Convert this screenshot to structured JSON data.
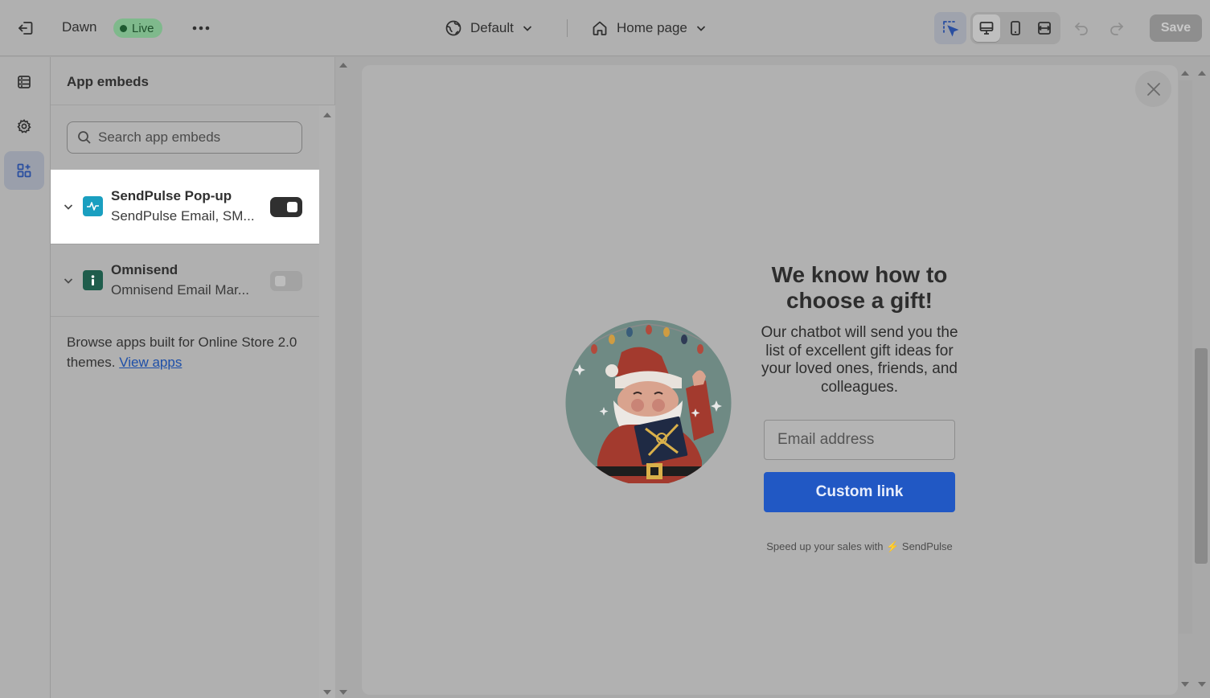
{
  "topbar": {
    "theme_name": "Dawn",
    "status_badge": "Live",
    "locale": "Default",
    "page_select": "Home page",
    "save_label": "Save"
  },
  "rail": {
    "items": [
      {
        "icon": "sections-icon"
      },
      {
        "icon": "settings-gear-icon"
      },
      {
        "icon": "app-embeds-icon",
        "active": true
      }
    ]
  },
  "panel": {
    "title": "App embeds",
    "search_placeholder": "Search app embeds",
    "embeds": [
      {
        "name": "SendPulse Pop-up",
        "description": "SendPulse Email, SM...",
        "enabled": true
      },
      {
        "name": "Omnisend",
        "description": "Omnisend Email Mar...",
        "enabled": false
      }
    ],
    "browse_text": "Browse apps built for Online Store 2.0 themes.",
    "browse_link": "View apps"
  },
  "popup": {
    "title": "We know how to choose a gift!",
    "text": "Our chatbot will send you the list of excellent gift ideas for your loved ones, friends, and colleagues.",
    "email_placeholder": "Email address",
    "button_label": "Custom link",
    "footer_prefix": "Speed up your sales with",
    "footer_brand": "SendPulse"
  },
  "colors": {
    "accent_button": "#2158c4",
    "live_badge": "#7fb98c",
    "sendpulse_logo": "#1a9fc0",
    "omnisend_logo": "#1f5d4c"
  }
}
